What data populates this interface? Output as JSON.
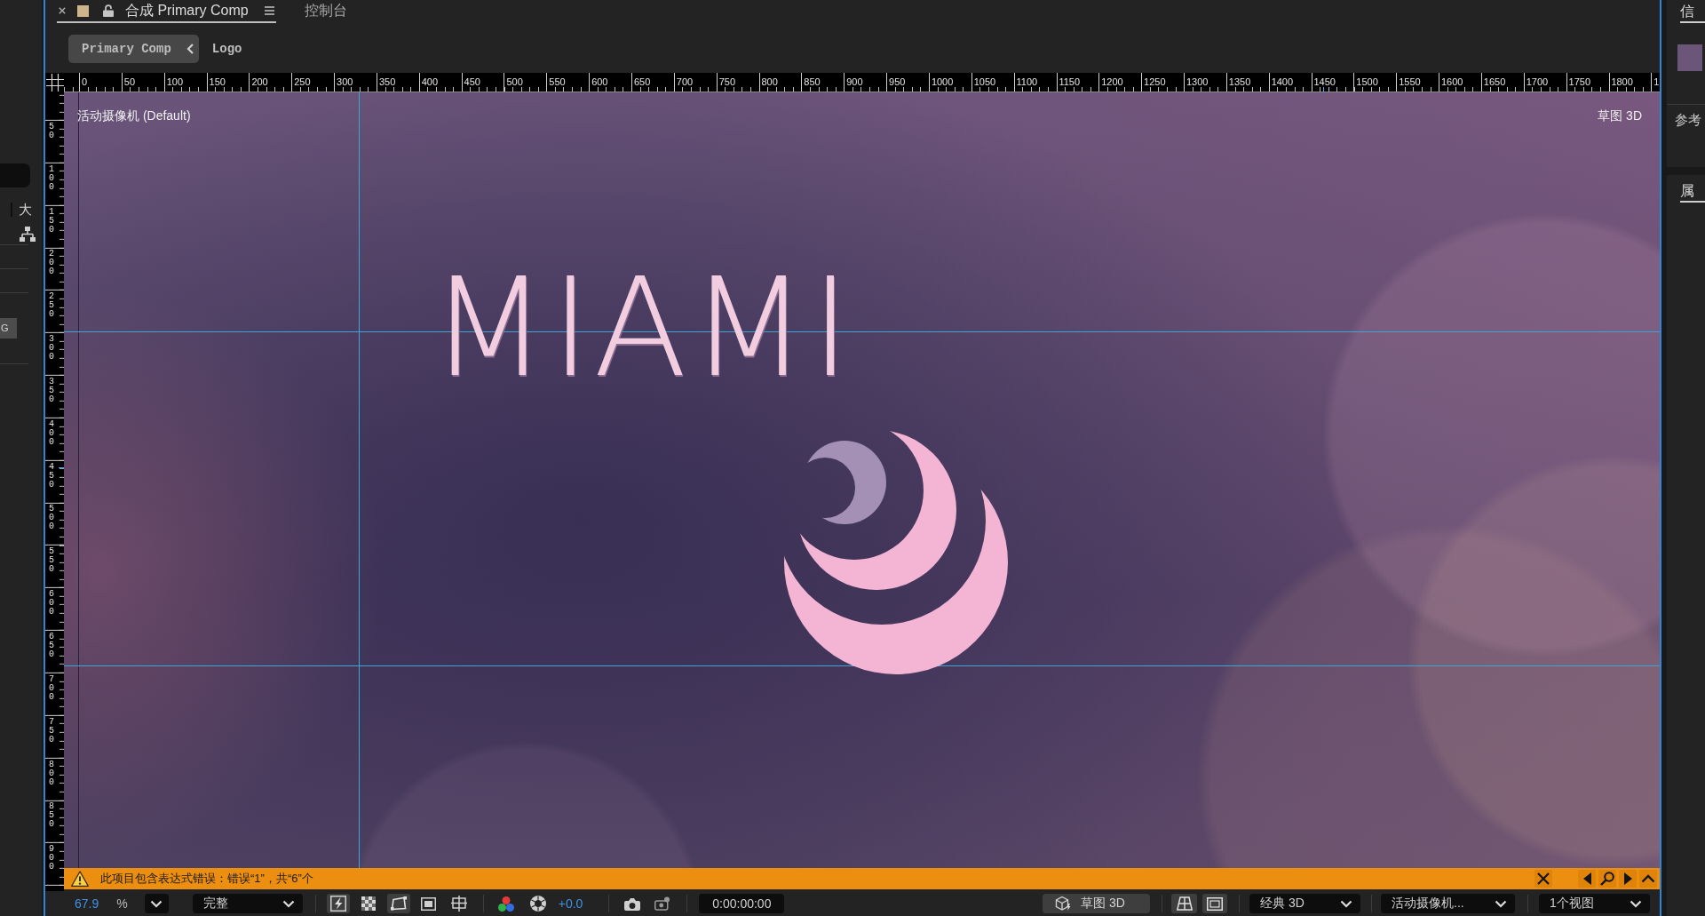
{
  "left_panel": {
    "column_header": "大",
    "button_label": "G"
  },
  "composition_panel": {
    "tabs": [
      {
        "label": "合成 Primary Comp",
        "selected": true
      },
      {
        "label": "控制台",
        "selected": false
      }
    ],
    "breadcrumbs": [
      {
        "label": "Primary Comp",
        "selected": true
      },
      {
        "label": "Logo",
        "selected": false
      }
    ],
    "ruler_top": {
      "labels": [
        "0",
        "50",
        "100",
        "150",
        "200",
        "250",
        "300",
        "350",
        "400",
        "450",
        "500",
        "550",
        "600",
        "650",
        "700",
        "750",
        "800",
        "850",
        "900",
        "950",
        "1000",
        "1050",
        "1100",
        "1150",
        "1200",
        "1250",
        "1300",
        "1350",
        "1400",
        "1450",
        "1500",
        "1550",
        "1600",
        "1650",
        "1700",
        "1750",
        "1800",
        "1"
      ]
    },
    "ruler_left": {
      "labels": [
        "50",
        "100",
        "150",
        "200",
        "250",
        "300",
        "350",
        "400",
        "450",
        "500",
        "550",
        "600",
        "650",
        "700",
        "750",
        "800",
        "850",
        "900"
      ]
    },
    "viewer": {
      "camera_label": "活动摄像机 (Default)",
      "renderer_label": "草图 3D",
      "title_text": "MIAMI"
    },
    "warning_bar": {
      "message": "此项目包含表达式错误：错误“1”，共“6”个"
    },
    "toolbar": {
      "zoom_value": "67.9",
      "zoom_unit": "%",
      "resolution": "完整",
      "toggles": [
        {
          "kind": "preview",
          "selected": true
        },
        {
          "kind": "checker",
          "selected": false
        },
        {
          "kind": "mask",
          "selected": true
        },
        {
          "kind": "region",
          "selected": false
        },
        {
          "kind": "grid",
          "selected": false
        }
      ],
      "exposure": "+0.0",
      "timecode": "0:00:00:00",
      "draft_3d": {
        "label": "草图 3D",
        "selected": true
      },
      "view_toggles": [
        {
          "kind": "floor",
          "selected": true
        },
        {
          "kind": "frame",
          "selected": true
        }
      ],
      "renderer": "经典 3D",
      "camera": "活动摄像机...",
      "view_layout": "1个视图"
    }
  },
  "right_panel": {
    "info_tab": {
      "label": "信",
      "selected": true
    },
    "reference_label": "参考",
    "properties_tab": {
      "label": "属",
      "selected": true
    }
  }
}
